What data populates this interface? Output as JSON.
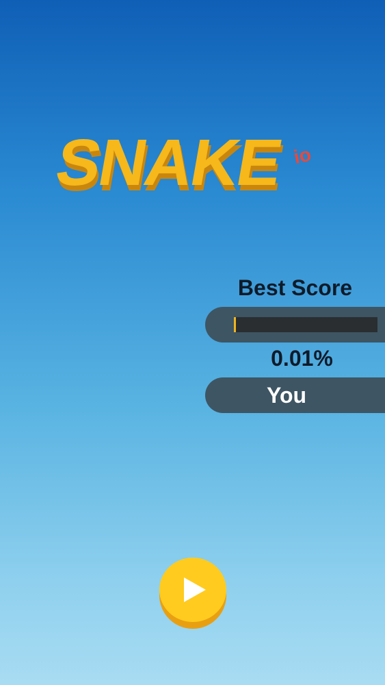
{
  "logo": {
    "main_text": "SNAKE",
    "suffix_text": "io",
    "main_color": "#f6b81a",
    "shadow_color": "#c9860e",
    "suffix_color": "#e8493c"
  },
  "score_panel": {
    "best_label": "Best Score",
    "progress_fraction": 0.0001,
    "percent_text": "0.01%",
    "player_label": "You"
  },
  "play_button": {
    "icon": "play-icon",
    "color": "#ffcb1e"
  }
}
